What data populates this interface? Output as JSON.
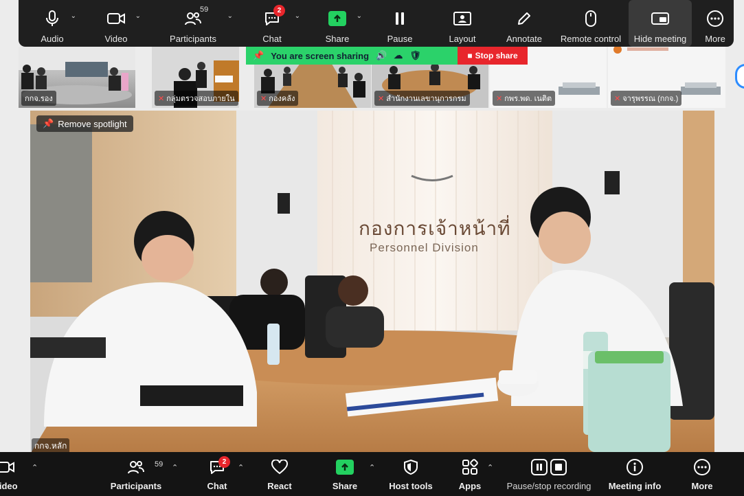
{
  "top_toolbar": {
    "audio": "Audio",
    "video": "Video",
    "participants": "Participants",
    "participants_count": "59",
    "chat": "Chat",
    "chat_badge": "2",
    "share": "Share",
    "pause": "Pause",
    "layout": "Layout",
    "annotate": "Annotate",
    "remote_control": "Remote control",
    "hide_meeting": "Hide meeting",
    "more": "More"
  },
  "sharing_bar": {
    "status": "You are screen sharing",
    "stop": "Stop share"
  },
  "thumbnails": [
    {
      "name": "กกจ.รอง"
    },
    {
      "name": "กลุ่มตรวจสอบภายใน"
    },
    {
      "name": "กองคลัง"
    },
    {
      "name": "สำนักงานเลขานุการกรม"
    },
    {
      "name": "กพร.พด. เนติต"
    },
    {
      "name": "จารุพรรณ (กกจ.)"
    }
  ],
  "main_video": {
    "spotlight_label": "Remove spotlight",
    "participant_name": "กกจ.หลัก",
    "wall_sign_thai": "กองการเจ้าหน้าที่",
    "wall_sign_en": "Personnel Division"
  },
  "bottom_toolbar": {
    "video": "Video",
    "participants": "Participants",
    "participants_count": "59",
    "chat": "Chat",
    "chat_badge": "2",
    "react": "React",
    "share": "Share",
    "host_tools": "Host tools",
    "apps": "Apps",
    "pause_stop_recording": "Pause/stop recording",
    "meeting_info": "Meeting info",
    "more": "More"
  },
  "colors": {
    "toolbar_bg": "#1f1f1f",
    "share_green": "#23d160",
    "stop_red": "#e8262c",
    "badge_red": "#e8262c",
    "accent_blue": "#2d8cff"
  }
}
